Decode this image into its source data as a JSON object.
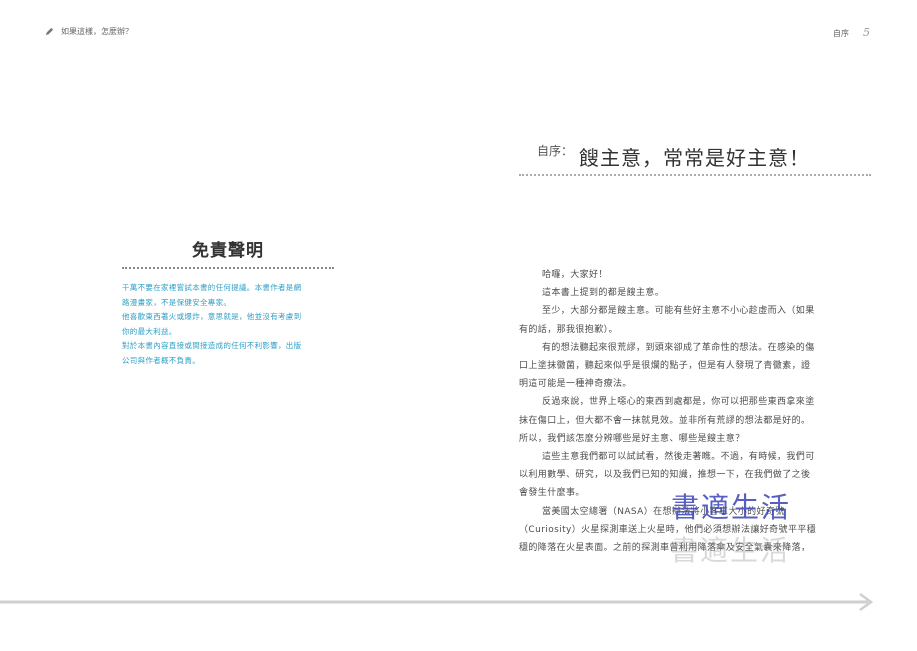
{
  "header": {
    "left_title": "如果這樣，怎麼辦？",
    "right_chapter": "自序",
    "page_number": "5"
  },
  "disclaimer": {
    "title": "免責聲明",
    "lines": [
      "千萬不要在家裡嘗試本書的任何提議。本書作者是網",
      "路漫畫家，不是保健安全專家。",
      "他喜歡東西著火或爆炸，意思就是，他並沒有考慮到",
      "你的最大利益。",
      "對於本書內容直接或間接造成的任何不利影響，出版",
      "公司與作者概不負責。"
    ]
  },
  "preface": {
    "prefix": "自序：",
    "title": "餿主意，常常是好主意！",
    "lines": [
      {
        "text": "哈囉，大家好！",
        "indent": true
      },
      {
        "text": "這本書上提到的都是餿主意。",
        "indent": true
      },
      {
        "text": "至少，大部分都是餿主意。可能有些好主意不小心趁虛而入（如果",
        "indent": true
      },
      {
        "text": "有的話，那我很抱歉）。",
        "indent": false
      },
      {
        "text": "有的想法聽起來很荒謬，到頭來卻成了革命性的想法。在感染的傷",
        "indent": true
      },
      {
        "text": "口上塗抹黴菌，聽起來似乎是很爛的點子，但是有人發現了青黴素，證",
        "indent": false
      },
      {
        "text": "明這可能是一種神奇療法。",
        "indent": false
      },
      {
        "text": "反過來說，世界上噁心的東西到處都是，你可以把那些東西拿來塗",
        "indent": true
      },
      {
        "text": "抹在傷口上，但大都不會一抹就見效。並非所有荒謬的想法都是好的。",
        "indent": false
      },
      {
        "text": "所以，我們該怎麼分辨哪些是好主意、哪些是餿主意？",
        "indent": false
      },
      {
        "text": "這些主意我們都可以試試看，然後走著瞧。不過，有時候，我們可",
        "indent": true
      },
      {
        "text": "以利用數學、研究，以及我們已知的知識，推想一下，在我們做了之後",
        "indent": false
      },
      {
        "text": "會發生什麼事。",
        "indent": false
      },
      {
        "text": "當美國太空總署（NASA）在想辦法將小客車大小的好奇號",
        "indent": true
      },
      {
        "text": "（Curiosity）火星探測車送上火星時，他們必須想辦法讓好奇號平平穩",
        "indent": false
      },
      {
        "text": "穩的降落在火星表面。之前的探測車曾利用降落傘及安全氣囊來降落，",
        "indent": false
      }
    ]
  },
  "watermark": {
    "text": "書適生活"
  }
}
